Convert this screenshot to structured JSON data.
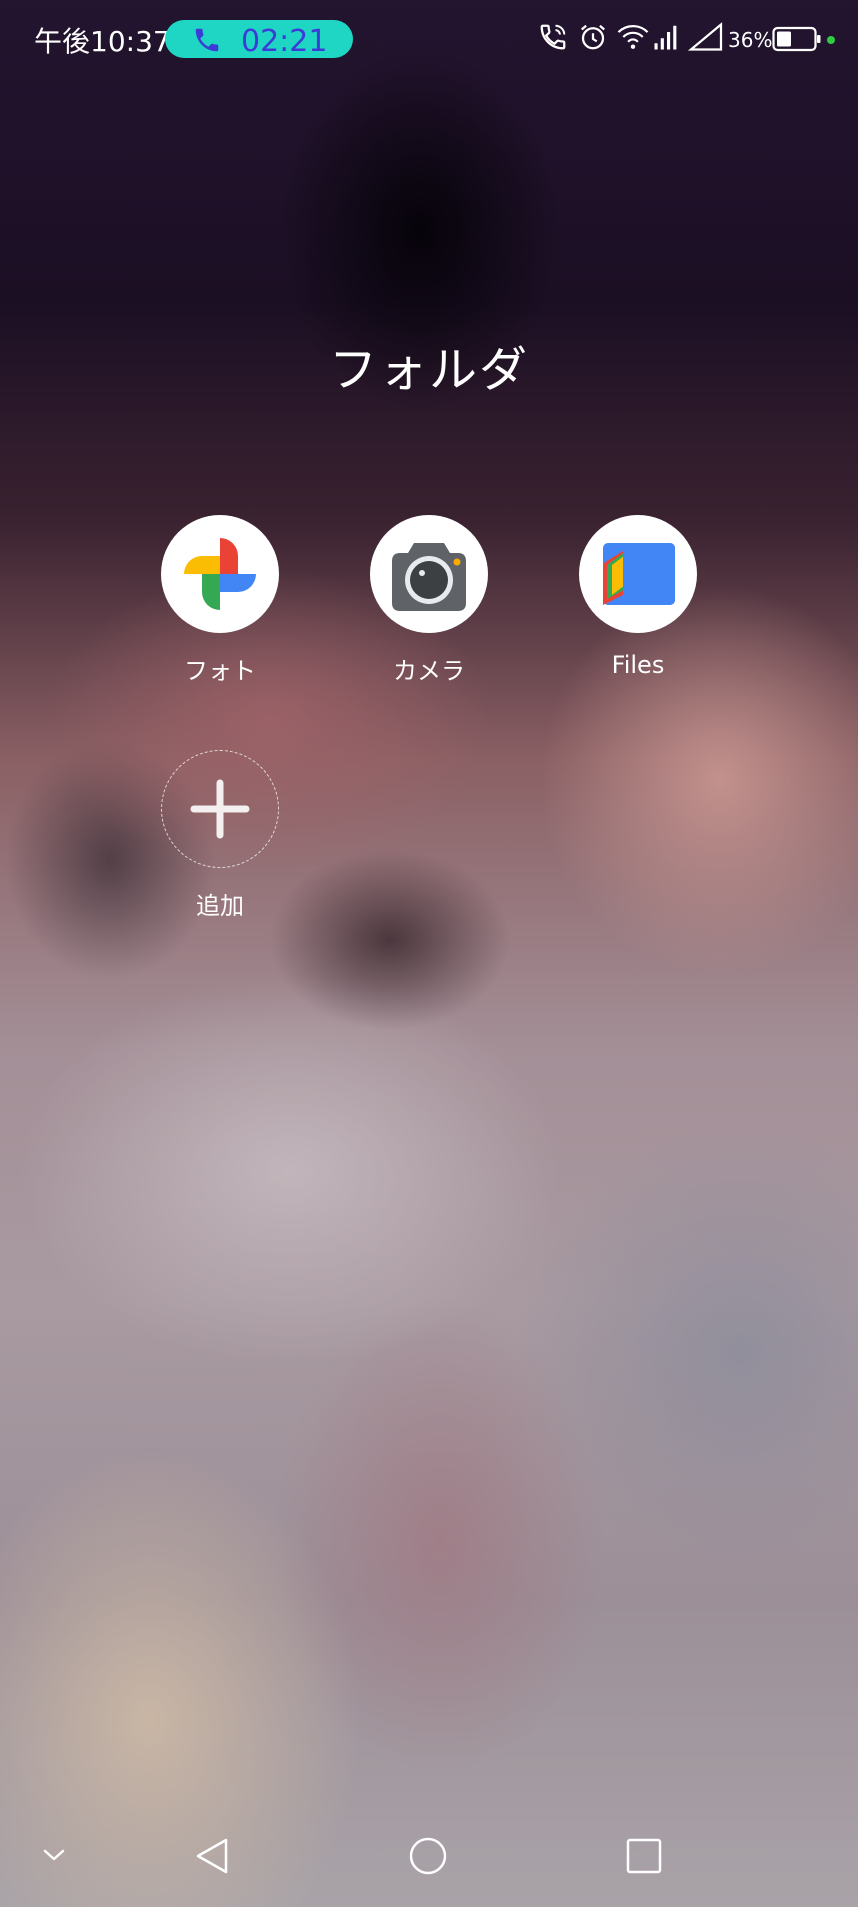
{
  "status_bar": {
    "time": "午後10:37",
    "call_duration": "02:21",
    "battery_percent": "36%",
    "icons": [
      "wifi-calling-icon",
      "alarm-icon",
      "wifi-icon",
      "signal-icon",
      "signal-empty-icon",
      "battery-icon"
    ],
    "call_pill_color": "#1fd6c4"
  },
  "folder": {
    "title": "フォルダ",
    "apps": [
      {
        "label": "フォト",
        "icon": "google-photos-icon"
      },
      {
        "label": "カメラ",
        "icon": "camera-icon"
      },
      {
        "label": "Files",
        "icon": "files-icon"
      }
    ],
    "add": {
      "label": "追加",
      "icon": "plus-icon"
    }
  },
  "nav_bar": {
    "buttons": [
      "collapse-icon",
      "back-icon",
      "home-icon",
      "recents-icon"
    ]
  }
}
